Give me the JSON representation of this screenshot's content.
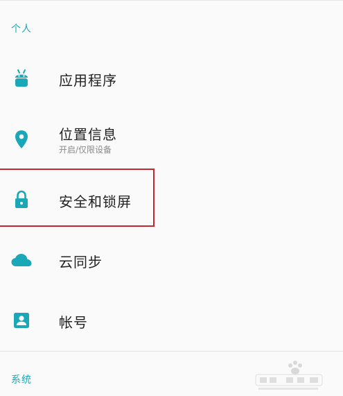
{
  "sections": {
    "personal": "个人",
    "system": "系统"
  },
  "items": [
    {
      "key": "apps",
      "title": "应用程序",
      "icon": "android-icon"
    },
    {
      "key": "location",
      "title": "位置信息",
      "subtitle": "开启/仅限设备",
      "icon": "location-pin-icon"
    },
    {
      "key": "security",
      "title": "安全和锁屏",
      "icon": "lock-icon"
    },
    {
      "key": "cloud",
      "title": "云同步",
      "icon": "cloud-icon"
    },
    {
      "key": "account",
      "title": "帐号",
      "icon": "account-icon"
    }
  ],
  "colors": {
    "accent": "#1aa8b8",
    "highlight": "#c9252f"
  }
}
